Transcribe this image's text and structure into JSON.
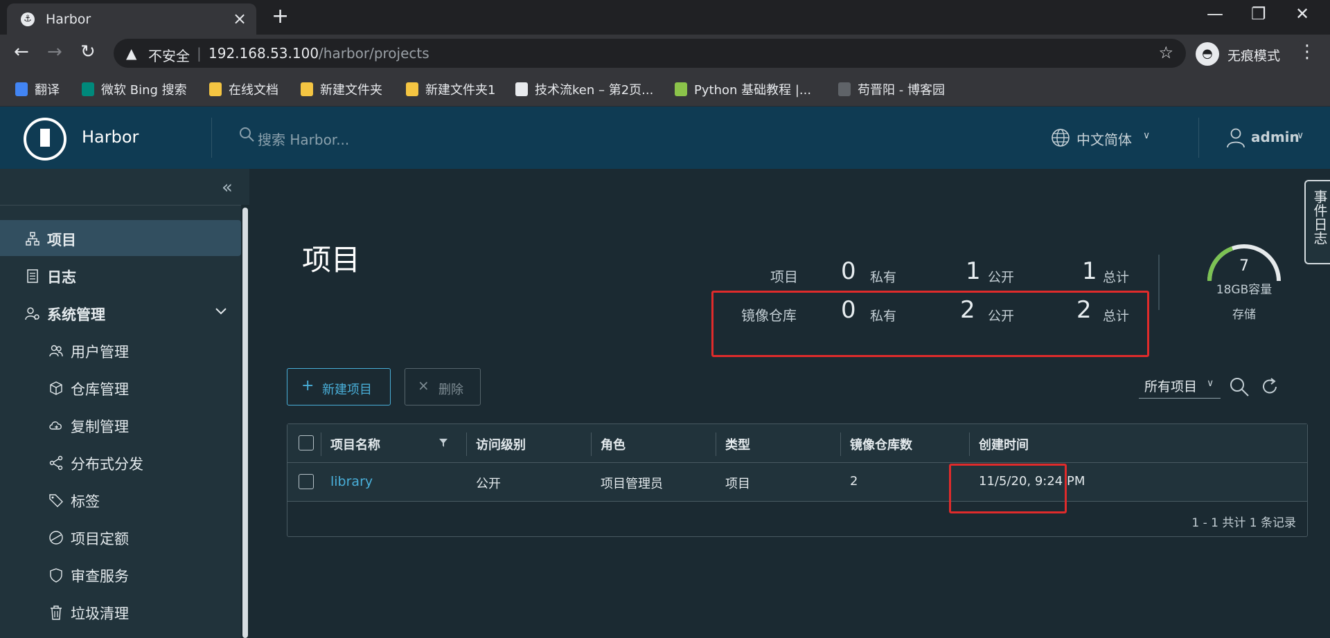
{
  "browser": {
    "tab_title": "Harbor",
    "insecure_label": "不安全",
    "separator": "|",
    "url_host": "192.168.53.100",
    "url_path": "/harbor/projects",
    "incognito_label": "无痕模式",
    "bookmarks": [
      {
        "label": "翻译",
        "icon_color": "#4285f4"
      },
      {
        "label": "微软 Bing 搜索",
        "icon_color": "#00897b"
      },
      {
        "label": "在线文档",
        "icon_color": "#f4c542"
      },
      {
        "label": "新建文件夹",
        "icon_color": "#f4c542"
      },
      {
        "label": "新建文件夹1",
        "icon_color": "#f4c542"
      },
      {
        "label": "技术流ken – 第2页...",
        "icon_color": "#e8eaed"
      },
      {
        "label": "Python 基础教程 |...",
        "icon_color": "#8bc34a"
      },
      {
        "label": "苟晋阳 - 博客园",
        "icon_color": "#5f6368"
      }
    ]
  },
  "header": {
    "brand": "Harbor",
    "search_placeholder": "搜索 Harbor...",
    "language": "中文简体",
    "user": "admin"
  },
  "sidebar": {
    "items": [
      {
        "label": "项目",
        "icon": "projects-icon"
      },
      {
        "label": "日志",
        "icon": "logs-icon"
      },
      {
        "label": "系统管理",
        "icon": "admin-icon"
      },
      {
        "label": "用户管理",
        "icon": "users-icon"
      },
      {
        "label": "仓库管理",
        "icon": "registry-icon"
      },
      {
        "label": "复制管理",
        "icon": "replication-icon"
      },
      {
        "label": "分布式分发",
        "icon": "distribution-icon"
      },
      {
        "label": "标签",
        "icon": "tag-icon"
      },
      {
        "label": "项目定额",
        "icon": "quota-icon"
      },
      {
        "label": "审查服务",
        "icon": "shield-icon"
      },
      {
        "label": "垃圾清理",
        "icon": "trash-icon"
      }
    ]
  },
  "main": {
    "title": "项目",
    "summary": {
      "rows": [
        {
          "label": "项目",
          "private": "0",
          "public": "1",
          "total": "1"
        },
        {
          "label": "镜像仓库",
          "private": "0",
          "public": "2",
          "total": "2"
        }
      ],
      "private_label": "私有",
      "public_label": "公开",
      "total_label": "总计"
    },
    "storage": {
      "value": "7",
      "capacity": "18GB容量",
      "label": "存储",
      "used_fraction": 0.39,
      "gauge_color": "#7cc253"
    },
    "buttons": {
      "new_project": "新建项目",
      "delete": "删除"
    },
    "filter": "所有项目",
    "table": {
      "columns": [
        "项目名称",
        "访问级别",
        "角色",
        "类型",
        "镜像仓库数",
        "创建时间"
      ],
      "rows": [
        {
          "name": "library",
          "access": "公开",
          "role": "项目管理员",
          "type": "项目",
          "repo_count": "2",
          "created": "11/5/20, 9:24 PM"
        }
      ],
      "footer": "1 - 1 共计 1 条记录"
    },
    "event_log": "事件日志"
  },
  "colors": {
    "accent": "#49afd9",
    "highlight": "#e02b2b",
    "header_bg": "#0f3b53"
  }
}
